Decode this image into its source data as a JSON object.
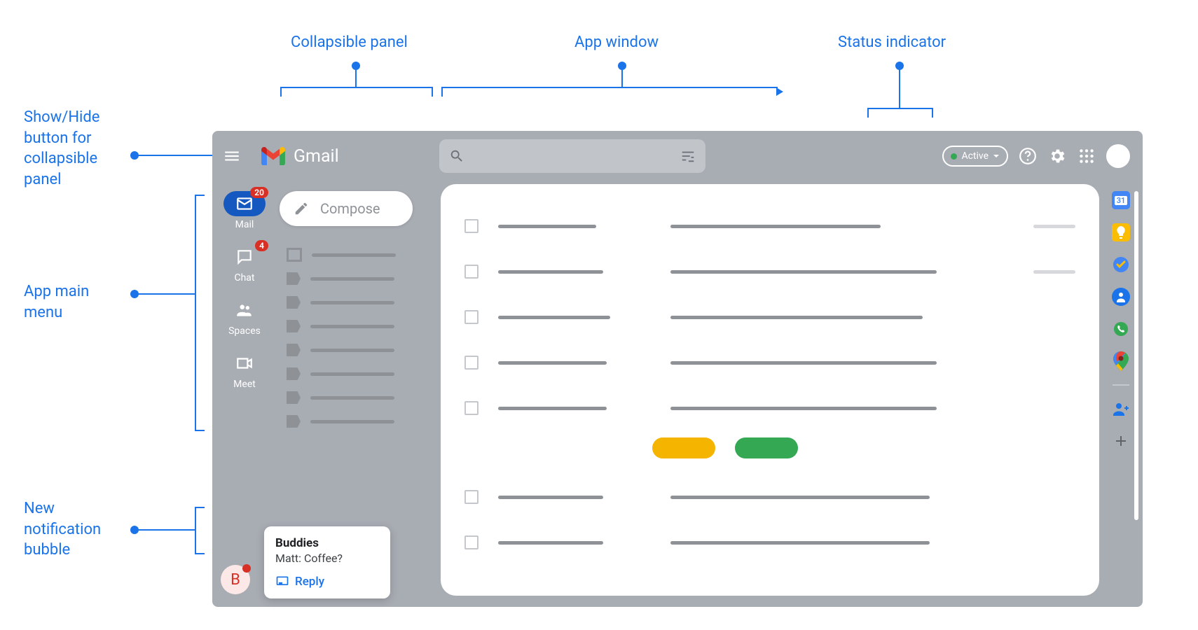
{
  "callouts": {
    "show_hide": "Show/Hide\nbutton for\ncollapsible\npanel",
    "collapsible_panel": "Collapsible panel",
    "app_window": "App window",
    "status_indicator": "Status indicator",
    "app_main_menu": "App main\nmenu",
    "notification_bubble": "New\nnotification\nbubble"
  },
  "header": {
    "app_name": "Gmail",
    "status_label": "Active"
  },
  "rail": {
    "mail": {
      "label": "Mail",
      "badge": "20"
    },
    "chat": {
      "label": "Chat",
      "badge": "4"
    },
    "spaces": {
      "label": "Spaces"
    },
    "meet": {
      "label": "Meet"
    }
  },
  "compose": {
    "label": "Compose"
  },
  "notification": {
    "avatar_initial": "B",
    "title": "Buddies",
    "message": "Matt: Coffee?",
    "reply": "Reply"
  },
  "side_apps": {
    "calendar_day": "31"
  },
  "colors": {
    "blue": "#1a73e8",
    "green_chip": "#34a853",
    "yellow_chip": "#f4b400"
  }
}
